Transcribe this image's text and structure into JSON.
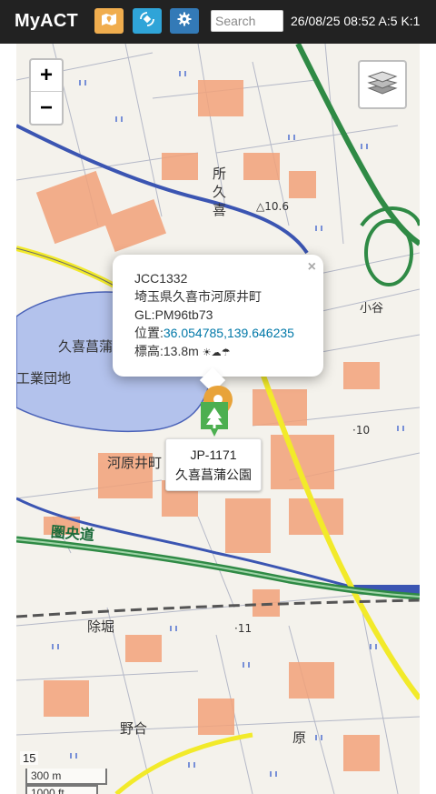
{
  "header": {
    "brand": "MyACT",
    "search_placeholder": "Search",
    "status": "26/08/25 08:52 A:5 K:1",
    "colors": {
      "bar": "#222222",
      "map_button": "#f0ad4e",
      "sat_button": "#2fa4d8",
      "settings_button": "#337ab7"
    },
    "icons": [
      "map-icon",
      "satellite-icon",
      "gear-icon"
    ]
  },
  "map": {
    "zoom_in": "+",
    "zoom_out": "−",
    "zoom_level": "15",
    "scale_metric": "300 m",
    "scale_imperial": "1000 ft",
    "places": {
      "tokorokuki_1": "所",
      "tokorokuki_2": "久",
      "tokorokuki_3": "喜",
      "kuki_shobu": "久喜菖蒲",
      "industrial": "工業団地",
      "kawarai": "河原井町",
      "ken_o_do": "圏央道",
      "jobori": "除堀",
      "nogo": "野合",
      "hara": "原",
      "kotani": "小谷",
      "el_10_6": "△10.6",
      "el_10": "·10",
      "el_11": "·11"
    }
  },
  "popup": {
    "close": "×",
    "call": "JCC1332",
    "address": "埼玉県久喜市河原井町",
    "grid": "GL:PM96tb73",
    "position_label": "位置:",
    "position_link": "36.054785,139.646235",
    "elevation": "標高:13.8m",
    "weather": "☀☁☂"
  },
  "marker": {
    "park_id": "JP-1171",
    "park_name": "久喜菖蒲公園",
    "icon": "tree-icon"
  }
}
